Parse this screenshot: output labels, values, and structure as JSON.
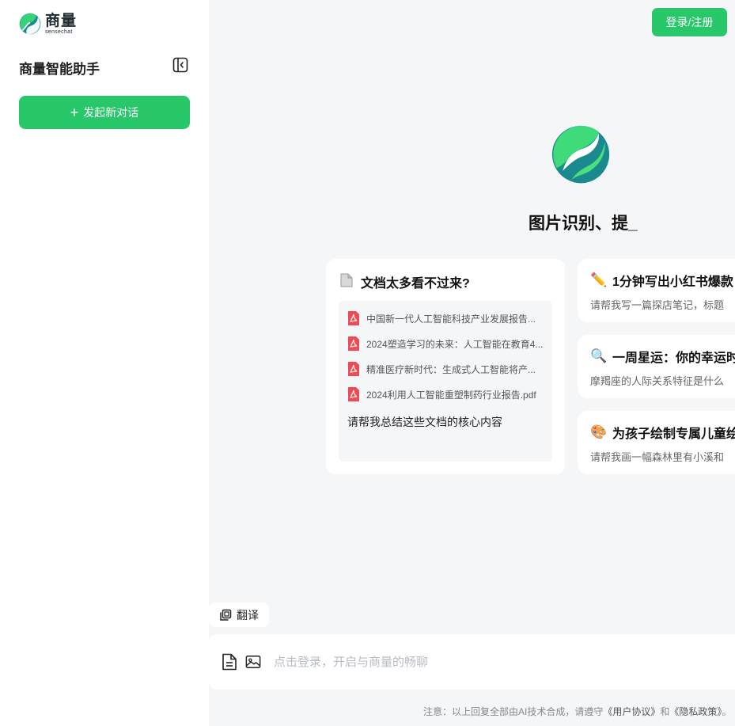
{
  "brand": {
    "name_cn": "商量",
    "name_en": "sensechat",
    "colors": {
      "primary": "#27c76a",
      "teal": "#1b8a8f",
      "accent_light": "#4be07c"
    }
  },
  "sidebar": {
    "title": "商量智能助手",
    "collapse_icon": "sidebar-collapse-icon",
    "new_chat_label": "发起新对话",
    "new_chat_icon": "plus"
  },
  "header": {
    "login_label": "登录/注册"
  },
  "hero": {
    "title": "图片识别、提_"
  },
  "cards": {
    "doc": {
      "icon": "page-icon",
      "emoji": "📄",
      "title": "文档太多看不过来?",
      "files": [
        "中国新一代人工智能科技产业发展报告...",
        "2024塑造学习的未来：人工智能在教育4...",
        "精准医疗新时代：生成式人工智能将产...",
        "2024利用人工智能重塑制药行业报告.pdf"
      ],
      "prompt": "请帮我总结这些文档的核心内容"
    },
    "xhs": {
      "emoji": "✏️",
      "title": "1分钟写出小红书爆款",
      "desc": "请帮我写一篇探店笔记，标题"
    },
    "star": {
      "emoji": "🔍",
      "title": "一周星运：你的幸运时",
      "desc": "摩羯座的人际关系特征是什么"
    },
    "draw": {
      "emoji": "🎨",
      "title": "为孩子绘制专属儿童绘",
      "desc": "请帮我画一幅森林里有小溪和"
    }
  },
  "toolbar": {
    "translate_label": "翻译"
  },
  "input": {
    "placeholder": "点击登录，开启与商量的畅聊",
    "value": ""
  },
  "footer": {
    "prefix": "注意：以上回复全部由AI技术合成，请遵守",
    "user_agreement": "《用户协议》",
    "and": "和",
    "privacy": "《隐私政策》",
    "suffix": "。"
  }
}
